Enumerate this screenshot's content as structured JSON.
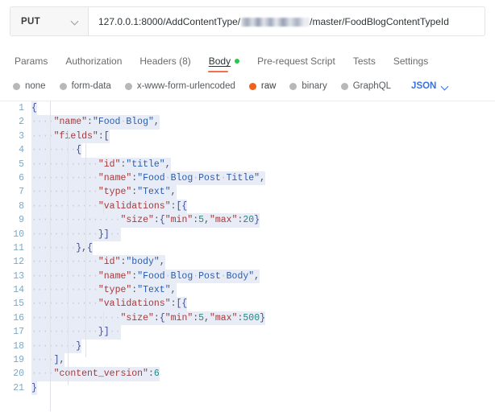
{
  "request": {
    "method": "PUT",
    "method_chevron_icon": "chevron-down-icon",
    "url_prefix": "127.0.0.1:8000/AddContentType/",
    "url_redacted": "",
    "url_suffix": "/master/FoodBlogContentTypeId",
    "url_full": "127.0.0.1:8000/AddContentType/████████/master/FoodBlogContentTypeId"
  },
  "tabs": [
    {
      "label": "Params",
      "active": false
    },
    {
      "label": "Authorization",
      "active": false
    },
    {
      "label": "Headers (8)",
      "active": false
    },
    {
      "label": "Body",
      "active": true
    },
    {
      "label": "Pre-request Script",
      "active": false
    },
    {
      "label": "Tests",
      "active": false
    },
    {
      "label": "Settings",
      "active": false
    }
  ],
  "body_types": [
    {
      "label": "none",
      "selected": false
    },
    {
      "label": "form-data",
      "selected": false
    },
    {
      "label": "x-www-form-urlencoded",
      "selected": false
    },
    {
      "label": "raw",
      "selected": true
    },
    {
      "label": "binary",
      "selected": false
    },
    {
      "label": "GraphQL",
      "selected": false
    }
  ],
  "format": {
    "label": "JSON",
    "chevron_icon": "chevron-down-icon"
  },
  "colors": {
    "accent_orange": "#f0601f",
    "tab_underline": "#f0714a",
    "status_dot_green": "#28c84b",
    "link_blue": "#3871e0",
    "gutter_blue": "#7fa8c4",
    "selection": "#e8ecf6",
    "key_red": "#a33b3b",
    "string_blue": "#2a5db0",
    "number_teal": "#1f8a82"
  },
  "editor": {
    "line_count": 21,
    "lines": [
      {
        "num": "1",
        "text": "{"
      },
      {
        "num": "2",
        "text": "    \"name\":\"Food Blog\","
      },
      {
        "num": "3",
        "text": "    \"fields\":["
      },
      {
        "num": "4",
        "text": "        {"
      },
      {
        "num": "5",
        "text": "            \"id\":\"title\","
      },
      {
        "num": "6",
        "text": "            \"name\":\"Food Blog Post Title\","
      },
      {
        "num": "7",
        "text": "            \"type\":\"Text\","
      },
      {
        "num": "8",
        "text": "            \"validations\":[{"
      },
      {
        "num": "9",
        "text": "                \"size\":{\"min\":5,\"max\":20}"
      },
      {
        "num": "10",
        "text": "            }]"
      },
      {
        "num": "11",
        "text": "        },{"
      },
      {
        "num": "12",
        "text": "            \"id\":\"body\","
      },
      {
        "num": "13",
        "text": "            \"name\":\"Food Blog Post Body\","
      },
      {
        "num": "14",
        "text": "            \"type\":\"Text\","
      },
      {
        "num": "15",
        "text": "            \"validations\":[{"
      },
      {
        "num": "16",
        "text": "                \"size\":{\"min\":5,\"max\":500}"
      },
      {
        "num": "17",
        "text": "            }]"
      },
      {
        "num": "18",
        "text": "        }"
      },
      {
        "num": "19",
        "text": "    ],"
      },
      {
        "num": "20",
        "text": "    \"content_version\":6"
      },
      {
        "num": "21",
        "text": "}"
      }
    ],
    "body_json": {
      "name": "Food Blog",
      "fields": [
        {
          "id": "title",
          "name": "Food Blog Post Title",
          "type": "Text",
          "validations": [
            {
              "size": {
                "min": 5,
                "max": 20
              }
            }
          ]
        },
        {
          "id": "body",
          "name": "Food Blog Post Body",
          "type": "Text",
          "validations": [
            {
              "size": {
                "min": 5,
                "max": 500
              }
            }
          ]
        }
      ],
      "content_version": 6
    }
  }
}
